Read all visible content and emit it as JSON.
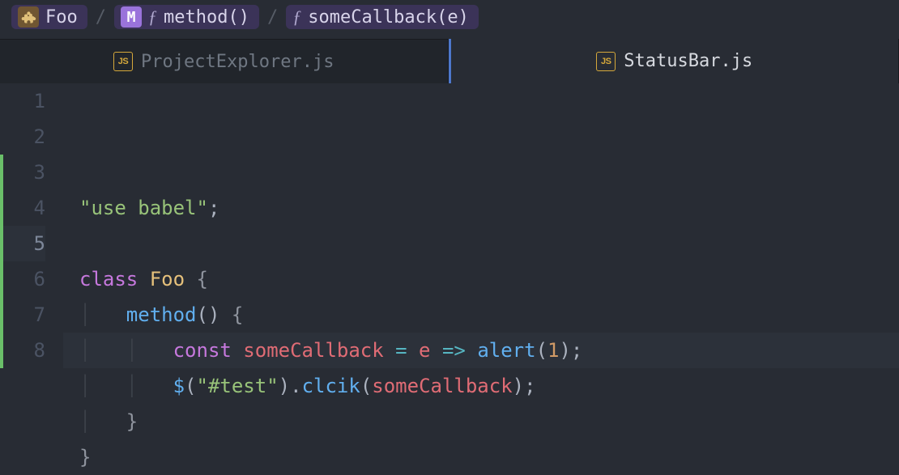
{
  "breadcrumbs": {
    "items": [
      {
        "icon": "puzzle",
        "label": "Foo"
      },
      {
        "icon": "M",
        "fprefix": true,
        "label": "method()"
      },
      {
        "fprefix": true,
        "label": "someCallback(e)"
      }
    ],
    "sep": "/"
  },
  "tabs": {
    "items": [
      {
        "name": "ProjectExplorer.js",
        "type": "js",
        "active": false
      },
      {
        "name": "StatusBar.js",
        "type": "js",
        "active": true
      }
    ]
  },
  "editor": {
    "line_count": 8,
    "current_line": 5,
    "modified_range": [
      3,
      8
    ],
    "lines": {
      "1": {
        "tokens": [
          {
            "cls": "str",
            "t": "\"use babel\""
          },
          {
            "cls": "punc",
            "t": ";"
          }
        ]
      },
      "2": {
        "tokens": []
      },
      "3": {
        "tokens": [
          {
            "cls": "kw",
            "t": "class"
          },
          {
            "cls": "plain",
            "t": " "
          },
          {
            "cls": "cls",
            "t": "Foo"
          },
          {
            "cls": "plain",
            "t": " "
          },
          {
            "cls": "brace",
            "t": "{"
          }
        ]
      },
      "4": {
        "indent": 1,
        "tokens": [
          {
            "cls": "fn",
            "t": "method"
          },
          {
            "cls": "punc",
            "t": "()"
          },
          {
            "cls": "plain",
            "t": " "
          },
          {
            "cls": "brace",
            "t": "{"
          }
        ]
      },
      "5": {
        "indent": 2,
        "tokens": [
          {
            "cls": "kw",
            "t": "const"
          },
          {
            "cls": "plain",
            "t": " "
          },
          {
            "cls": "var",
            "t": "someCallback"
          },
          {
            "cls": "plain",
            "t": " "
          },
          {
            "cls": "op",
            "t": "="
          },
          {
            "cls": "plain",
            "t": " "
          },
          {
            "cls": "var",
            "t": "e"
          },
          {
            "cls": "plain",
            "t": " "
          },
          {
            "cls": "op",
            "t": "=>"
          },
          {
            "cls": "plain",
            "t": " "
          },
          {
            "cls": "fn",
            "t": "alert"
          },
          {
            "cls": "punc",
            "t": "("
          },
          {
            "cls": "num",
            "t": "1"
          },
          {
            "cls": "punc",
            "t": ");"
          }
        ]
      },
      "6": {
        "indent": 2,
        "tokens": [
          {
            "cls": "fn",
            "t": "$"
          },
          {
            "cls": "punc",
            "t": "("
          },
          {
            "cls": "str",
            "t": "\"#test\""
          },
          {
            "cls": "punc",
            "t": ")."
          },
          {
            "cls": "fn",
            "t": "clcik"
          },
          {
            "cls": "punc",
            "t": "("
          },
          {
            "cls": "var",
            "t": "someCallback"
          },
          {
            "cls": "punc",
            "t": ");"
          }
        ]
      },
      "7": {
        "indent": 1,
        "tokens": [
          {
            "cls": "brace",
            "t": "}"
          }
        ]
      },
      "8": {
        "tokens": [
          {
            "cls": "brace",
            "t": "}"
          }
        ]
      }
    }
  },
  "colors": {
    "bg": "#282c34",
    "accent": "#4d78cc",
    "string": "#98c379",
    "keyword": "#c678dd",
    "class": "#e5c07b",
    "function": "#61afef",
    "variable": "#e06c75",
    "operator": "#56b6c2",
    "number": "#d19a66"
  }
}
